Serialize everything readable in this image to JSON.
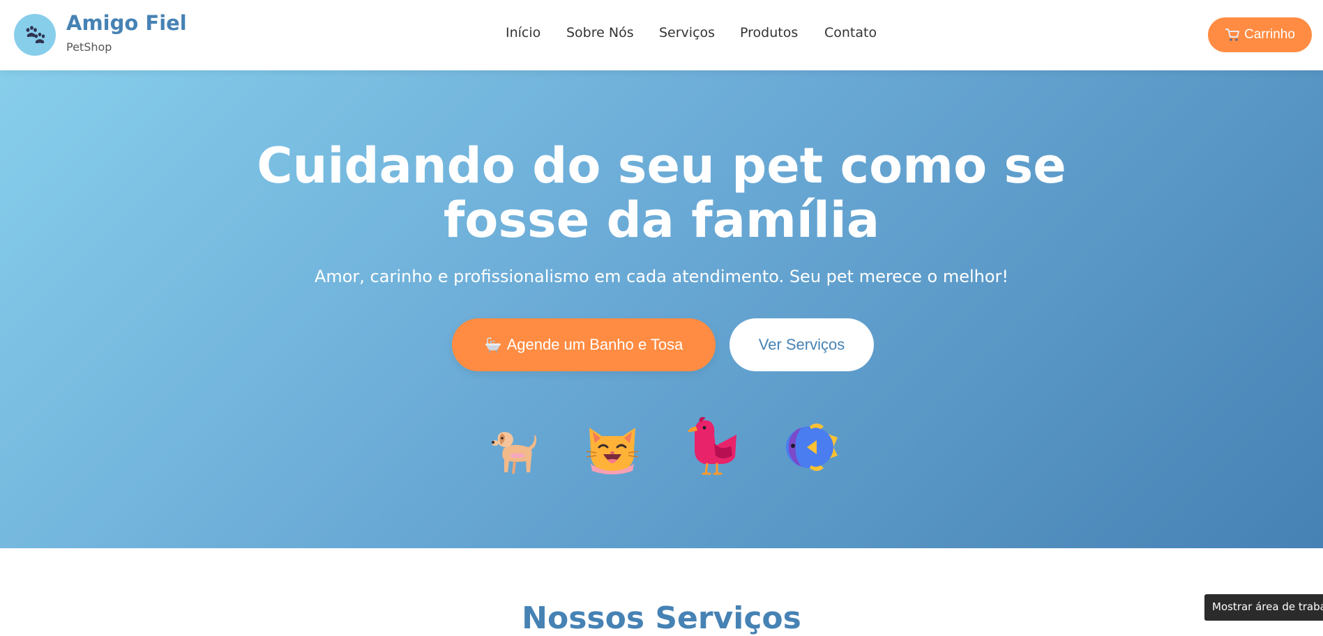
{
  "brand": {
    "name": "Amigo Fiel",
    "subtitle": "PetShop",
    "logo_icon": "paw-icon"
  },
  "nav": {
    "items": [
      {
        "label": "Início"
      },
      {
        "label": "Sobre Nós"
      },
      {
        "label": "Serviços"
      },
      {
        "label": "Produtos"
      },
      {
        "label": "Contato"
      }
    ]
  },
  "cart": {
    "icon": "cart-icon",
    "label": "Carrinho"
  },
  "hero": {
    "title_line1": "Cuidando do seu pet como se",
    "title_line2": "fosse da família",
    "subtitle": "Amor, carinho e profissionalismo em cada atendimento. Seu pet merece o melhor!",
    "primary_button": {
      "icon": "bathtub-icon",
      "label": "Agende um Banho e Tosa"
    },
    "secondary_button": {
      "label": "Ver Serviços"
    },
    "pets": [
      "dog-icon",
      "cat-icon",
      "bird-icon",
      "fish-icon"
    ]
  },
  "services": {
    "title": "Nossos Serviços"
  },
  "tooltip": {
    "text": "Mostrar área de trabalho"
  },
  "colors": {
    "brand_blue": "#4682b4",
    "sky_blue": "#87ceeb",
    "accent_orange": "#ff8c42",
    "white": "#ffffff"
  }
}
